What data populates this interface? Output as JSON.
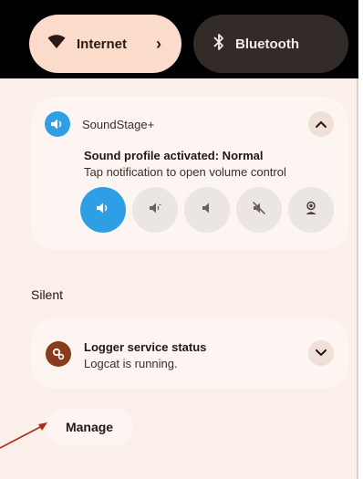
{
  "quick_tiles": {
    "internet": {
      "label": "Internet",
      "icon": "wifi-icon"
    },
    "bluetooth": {
      "label": "Bluetooth",
      "icon": "bluetooth-icon"
    }
  },
  "sound_notification": {
    "app_name": "SoundStage+",
    "app_icon": "volume-icon",
    "title": "Sound profile activated: Normal",
    "text": "Tap notification to open volume control",
    "profiles": [
      {
        "name": "normal-profile",
        "icon": "volume-full-icon",
        "active": true
      },
      {
        "name": "low-volume-profile",
        "icon": "volume-low-icon",
        "active": false
      },
      {
        "name": "quiet-profile",
        "icon": "volume-min-icon",
        "active": false
      },
      {
        "name": "mute-profile",
        "icon": "volume-mute-icon",
        "active": false
      },
      {
        "name": "custom-profile",
        "icon": "person-icon",
        "active": false
      }
    ]
  },
  "silent_section": {
    "label": "Silent"
  },
  "logger_notification": {
    "app_icon": "gears-icon",
    "title": "Logger service status",
    "text": "Logcat is running."
  },
  "manage": {
    "label": "Manage"
  },
  "colors": {
    "accent": "#2e9fe4",
    "panel_bg": "#fbefe9",
    "card_bg": "#fcf5f1",
    "annotation_arrow": "#b0281f"
  }
}
